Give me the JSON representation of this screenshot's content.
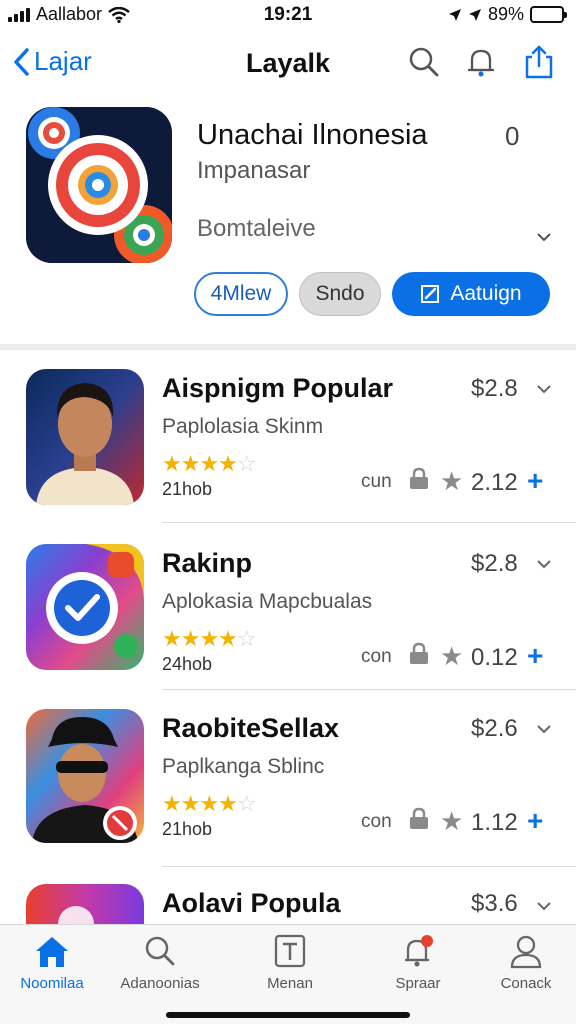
{
  "status_bar": {
    "carrier": "Aallabor",
    "time": "19:21",
    "battery": "89%"
  },
  "nav": {
    "back_label": "Lajar",
    "title": "Layalk"
  },
  "featured": {
    "name": "Unachai Ilnonesia",
    "subtitle": "Impanasar",
    "category": "Bomtaleive",
    "count": "0",
    "buttons": {
      "outline": "4Mlew",
      "grey": "Sndo",
      "primary": "Aatuign"
    },
    "colors": {
      "primary": "#0b6fe6"
    }
  },
  "apps": [
    {
      "name": "Aispnigm Popular",
      "subtitle": "Paplolasia Skinm",
      "stars": 4.5,
      "count": "21hob",
      "price": "$2.8",
      "meta": "cun",
      "rating": "2.12"
    },
    {
      "name": "Rakinp",
      "subtitle": "Aplokasia Mapcbualas",
      "stars": 4.5,
      "count": "24hob",
      "price": "$2.8",
      "meta": "con",
      "rating": "0.12"
    },
    {
      "name": "RaobiteSellax",
      "subtitle": "Paplkanga Sblinc",
      "stars": 4.5,
      "count": "21hob",
      "price": "$2.6",
      "meta": "con",
      "rating": "1.12"
    },
    {
      "name": "Aolavi Popula",
      "subtitle": "",
      "stars": 0,
      "count": "",
      "price": "$3.6",
      "meta": "",
      "rating": ""
    }
  ],
  "tabs": [
    {
      "label": "Noomilaa",
      "icon": "home-icon",
      "active": true
    },
    {
      "label": "Adanoonias",
      "icon": "search-icon",
      "active": false
    },
    {
      "label": "Menan",
      "icon": "text-box-icon",
      "active": false
    },
    {
      "label": "Spraar",
      "icon": "bell-badge-icon",
      "active": false
    },
    {
      "label": "Conack",
      "icon": "profile-icon",
      "active": false
    }
  ]
}
